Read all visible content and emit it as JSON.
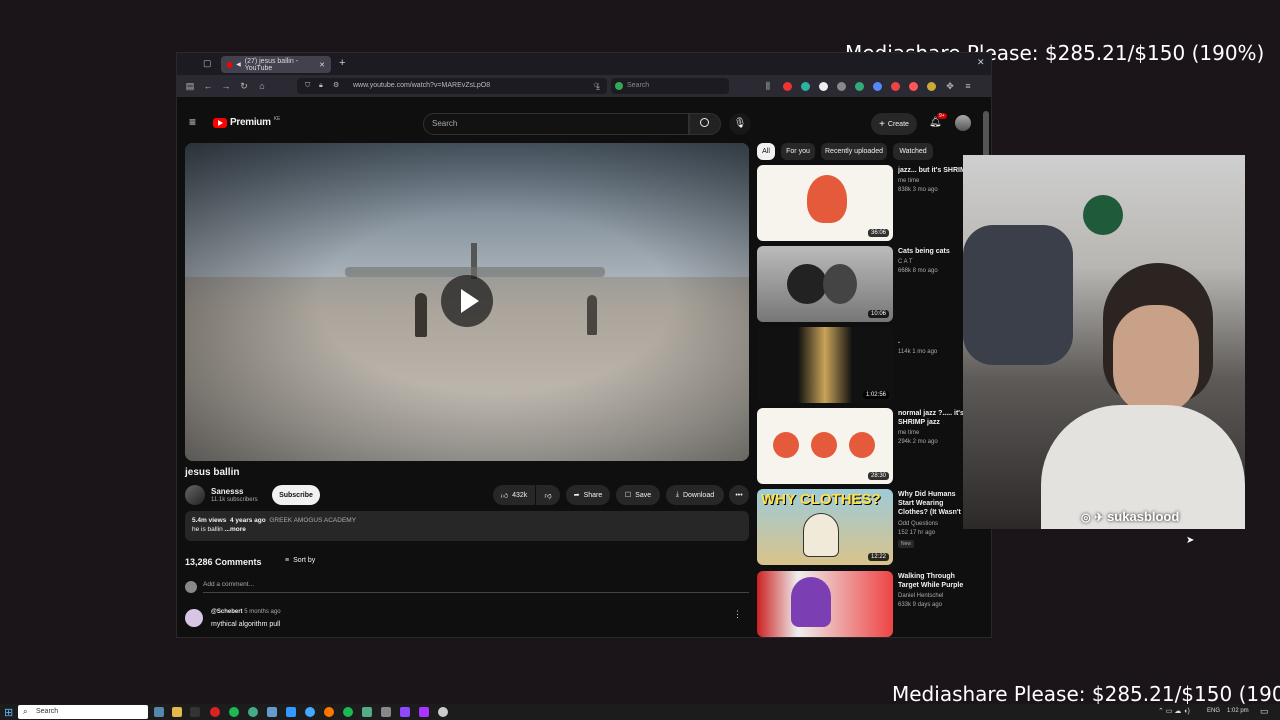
{
  "overlay": {
    "top_text": "Mediashare Please: $285.21/$150 (190%)",
    "bottom_text": "Mediashare Please: $285.21/$150 (190%)"
  },
  "browser": {
    "tab_title": "(27) jesus ballin - YouTube",
    "url": "www.youtube.com/watch?v=MAREvZsLpO8",
    "search_placeholder": "Search"
  },
  "youtube": {
    "logo_text": "Premium",
    "logo_super": "KE",
    "search_placeholder": "Search",
    "create_label": "Create",
    "notification_count": "9+",
    "video": {
      "title": "jesus ballin",
      "channel_name": "Sanesss",
      "subscribers": "11.1k subscribers",
      "subscribe_label": "Subscribe",
      "likes": "432k",
      "share_label": "Share",
      "save_label": "Save",
      "download_label": "Download",
      "views": "5.4m views",
      "age": "4 years ago",
      "hashtag": "GREEK AMOGUS ACADEMY",
      "description": "he is ballin",
      "more_label": "...more"
    },
    "comments": {
      "count_label": "13,286 Comments",
      "sort_label": "Sort by",
      "add_placeholder": "Add a comment...",
      "first": {
        "author": "@Schebert",
        "age": "5 months ago",
        "text": "mythical algorithm pull"
      }
    },
    "chips": [
      "All",
      "For you",
      "Recently uploaded",
      "Watched"
    ],
    "recommendations": [
      {
        "title": "jazz... but it's SHRIMP",
        "channel": "me time",
        "meta": "838k   3 mo ago",
        "duration": "36:06"
      },
      {
        "title": "Cats being cats",
        "channel": "C A T",
        "meta": "668k   8 mo ago",
        "duration": "10:06"
      },
      {
        "title": ".",
        "channel": "",
        "meta": "114k   1 mo ago",
        "duration": "1:02:56"
      },
      {
        "title": "normal jazz ?..... it's SHRIMP jazz",
        "channel": "me time",
        "meta": "294k   2 mo ago",
        "duration": "28:30"
      },
      {
        "title": "Why Did Humans Start Wearing Clothes? (It Wasn't Modesty)",
        "channel": "Odd Questions",
        "meta": "152   17 hr ago",
        "badge": "New",
        "duration": "12:22",
        "thumb_text": "WHY CLOTHES?"
      },
      {
        "title": "Walking Through Target While Purple",
        "channel": "Daniel Hentschel",
        "meta": "633k   9 days ago",
        "duration": ""
      }
    ]
  },
  "webcam": {
    "handle": "sukasblood"
  },
  "taskbar": {
    "search_placeholder": "Search",
    "lang": "ENG",
    "time": "1:02 pm"
  }
}
